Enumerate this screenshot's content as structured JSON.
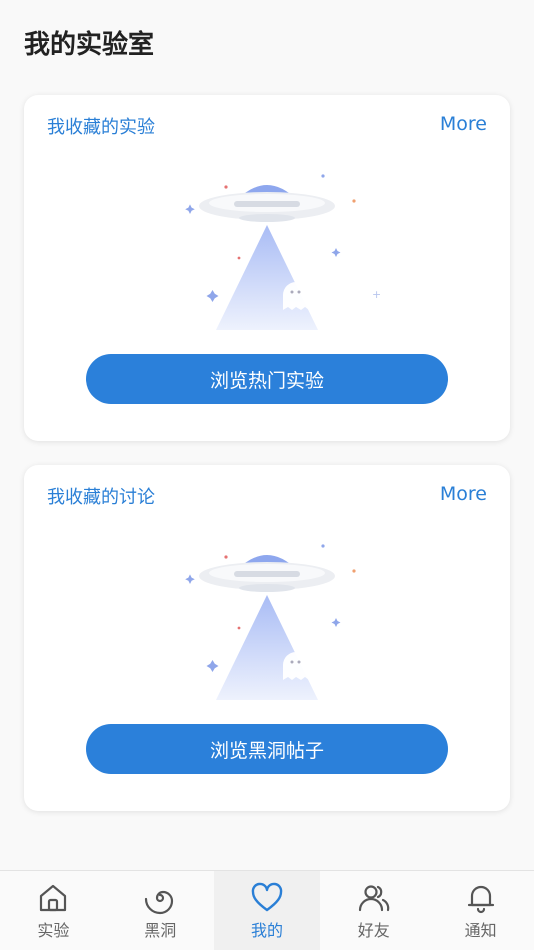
{
  "page": {
    "title": "我的实验室"
  },
  "cards": [
    {
      "title": "我收藏的实验",
      "more_label": "More",
      "button_label": "浏览热门实验"
    },
    {
      "title": "我收藏的讨论",
      "more_label": "More",
      "button_label": "浏览黑洞帖子"
    }
  ],
  "tabbar": {
    "active_index": 2,
    "tabs": [
      {
        "label": "实验",
        "icon": "home-icon"
      },
      {
        "label": "黑洞",
        "icon": "spiral-icon"
      },
      {
        "label": "我的",
        "icon": "heart-icon"
      },
      {
        "label": "好友",
        "icon": "friends-icon"
      },
      {
        "label": "通知",
        "icon": "bell-icon"
      }
    ]
  },
  "colors": {
    "accent": "#2a7fd6",
    "button": "#2b80da",
    "text_dark": "#222222",
    "tab_inactive": "#666666"
  }
}
